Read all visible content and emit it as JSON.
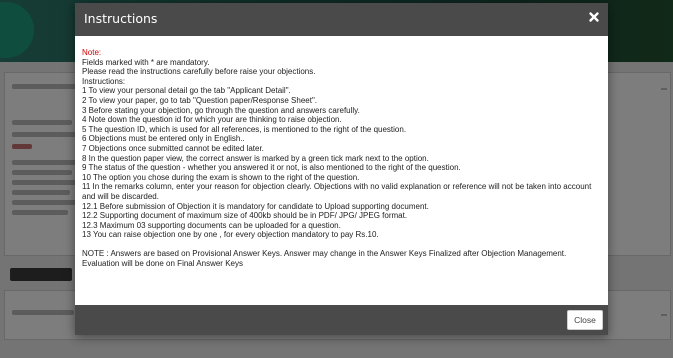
{
  "modal": {
    "title": "Instructions",
    "close_label": "Close",
    "note_label": "Note:",
    "lines": [
      "Fields marked with * are mandatory.",
      "Please read the instructions carefully before raise your objections.",
      "Instructions:",
      "1 To view your personal detail go the tab \"Applicant Detail\".",
      "2 To view your paper, go to tab \"Question paper/Response Sheet\".",
      "3 Before stating your objection, go through the question and answers carefully.",
      "4 Note down the question id for which your are thinking to raise objection.",
      "5 The question ID, which is used for all references, is mentioned to the right of the question.",
      "6 Objections must be entered only in English..",
      "7 Objections once submitted cannot be edited later.",
      "8 In the question paper view, the correct answer is marked by a green tick mark next to the option.",
      "9 The status of the question - whether you answered it or not, is also mentioned to the right of the question.",
      "10 The option you chose during the exam is shown to the right of the question.",
      "11 In the remarks column, enter your reason for objection clearly. Objections with no valid explanation or reference will not be taken into account and will be discarded.",
      "12.1 Before submission of Objection it is mandatory for candidate to Upload supporting document.",
      "12.2 Supporting document of maximum size of 400kb should be in PDF/ JPG/ JPEG format.",
      "12.3 Maximum 03 supporting documents can be uploaded for a question.",
      "13 You can raise objection one by one , for every objection mandatory to pay Rs.10."
    ],
    "footnote": "NOTE : Answers are based on Provisional Answer Keys. Answer may change in the Answer Keys Finalized after Objection Management. Evaluation will be done on Final Answer Keys"
  },
  "colors": {
    "header_bg": "#4a4a4a",
    "note_red": "#d40000",
    "overlay": "rgba(0,0,0,0.5)"
  },
  "icons": {
    "close": "close-icon"
  }
}
